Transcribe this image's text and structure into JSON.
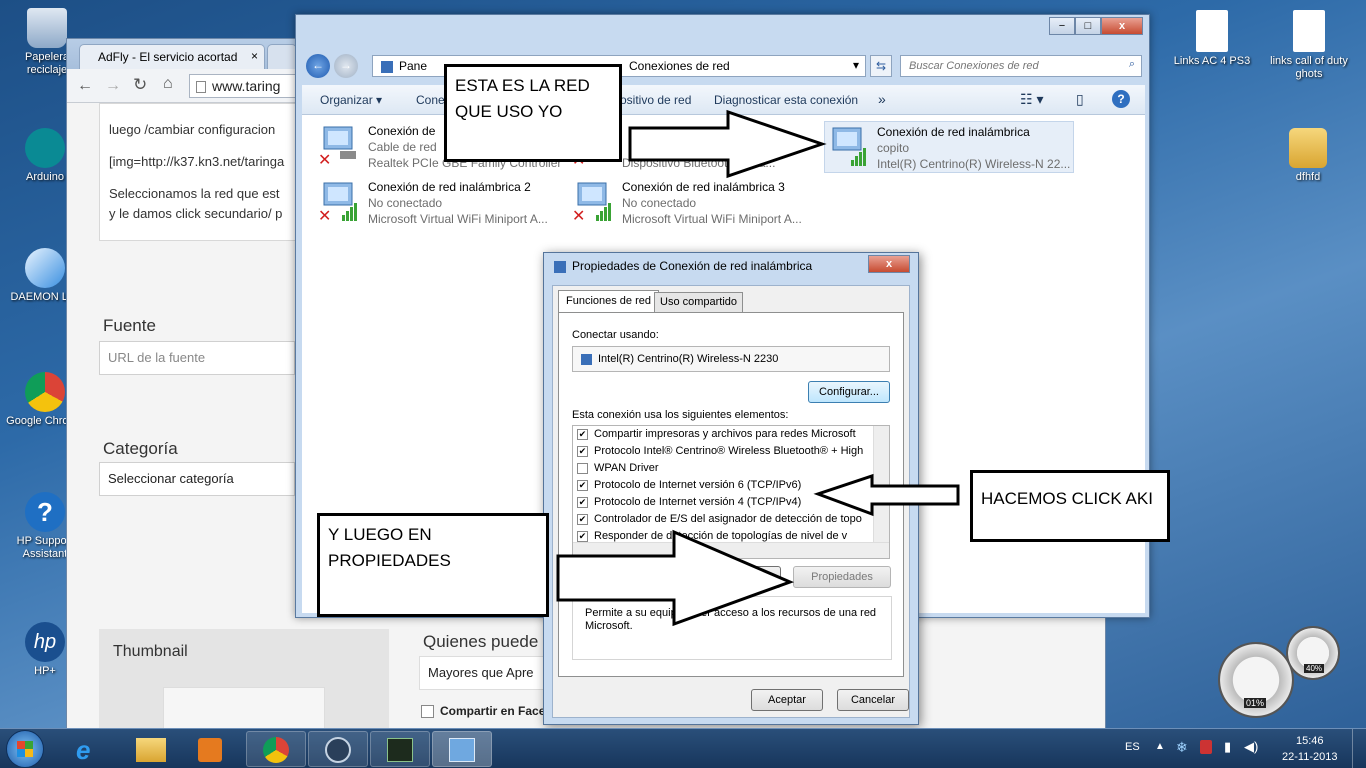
{
  "desktop": {
    "icons": [
      {
        "label": "Papelera reciclaje"
      },
      {
        "label": "Arduino"
      },
      {
        "label": "DAEMON Lite"
      },
      {
        "label": "Google Chrome"
      },
      {
        "label": "HP Support Assistant"
      },
      {
        "label": "HP+"
      },
      {
        "label": "Links AC 4 PS3"
      },
      {
        "label": "links call of duty ghots"
      },
      {
        "label": "dfhfd"
      }
    ]
  },
  "browser": {
    "tabs": [
      {
        "label": "AdFly - El servicio acortad"
      },
      {
        "label": ""
      }
    ],
    "tab_close": "×",
    "address": "www.taring",
    "content": {
      "line1": "luego  /cambiar configuracion",
      "line2": "[img=http://k37.kn3.net/taringa",
      "line3": "Seleccionamos la red que est",
      "line4": "y le damos click secundario/ p",
      "fuente_label": "Fuente",
      "fuente_placeholder": "URL de la fuente",
      "categoria_label": "Categoría",
      "categoria_value": "Seleccionar categoría",
      "thumbnail_label": "Thumbnail",
      "quienes_label": "Quienes puede",
      "mayores_value": "Mayores que Apre",
      "compartir_label": "Compartir en Face"
    }
  },
  "explorer": {
    "breadcrumb_root": "Pane",
    "breadcrumb_current": "Conexiones de red",
    "search_placeholder": "Buscar Conexiones de red",
    "toolbar": {
      "organizar": "Organizar",
      "conectar": "Cone",
      "dispositivo": "ositivo de red",
      "diagnosticar": "Diagnosticar esta conexión",
      "more": "»"
    },
    "connections": [
      {
        "name": "Conexión de",
        "status": "Cable de red",
        "device": "Realtek PCIe GBE Family Controller"
      },
      {
        "name": "",
        "status": "",
        "device": "Dispositivo Bluetooth (área..."
      },
      {
        "name": "Conexión de red inalámbrica",
        "status": "copito",
        "device": "Intel(R) Centrino(R) Wireless-N 22..."
      },
      {
        "name": "Conexión de red inalámbrica 2",
        "status": "No conectado",
        "device": "Microsoft Virtual WiFi Miniport A..."
      },
      {
        "name": "Conexión de red inalámbrica 3",
        "status": "No conectado",
        "device": "Microsoft Virtual WiFi Miniport A..."
      }
    ]
  },
  "dialog": {
    "title": "Propiedades de Conexión de red inalámbrica",
    "close": "x",
    "tabs": [
      {
        "label": "Funciones de red"
      },
      {
        "label": "Uso compartido"
      }
    ],
    "connect_using_label": "Conectar usando:",
    "adapter": "Intel(R) Centrino(R) Wireless-N 2230",
    "configure_button": "Configurar...",
    "items_label": "Esta conexión usa los siguientes elementos:",
    "items": [
      {
        "label": "Compartir impresoras y archivos para redes Microsoft",
        "checked": true
      },
      {
        "label": "Protocolo Intel® Centrino® Wireless Bluetooth® + High",
        "checked": true
      },
      {
        "label": "WPAN Driver",
        "checked": false
      },
      {
        "label": "Protocolo de Internet versión 6 (TCP/IPv6)",
        "checked": true
      },
      {
        "label": "Protocolo de Internet versión 4 (TCP/IPv4)",
        "checked": true
      },
      {
        "label": "Controlador de E/S del asignador de detección de topo",
        "checked": true
      },
      {
        "label": "Responder de detección de topologías de nivel de v",
        "checked": true
      }
    ],
    "properties_button": "Propiedades",
    "description": "Permite a su equipo tener acceso a los recursos de una red Microsoft.",
    "accept_button": "Aceptar",
    "cancel_button": "Cancelar"
  },
  "callouts": {
    "red": "ESTA ES LA RED QUE USO YO",
    "click": "HACEMOS CLICK AKI",
    "propiedades": "Y LUEGO EN PROPIEDADES"
  },
  "taskbar": {
    "language": "ES",
    "time": "15:46",
    "date": "22-11-2013"
  },
  "gadget": {
    "cpu": "01%",
    "ram": "40%"
  },
  "colors": {
    "taskbar": "#1d3d63",
    "desktop": "#2d6aa8",
    "selection": "#e6eef8",
    "signal": "#3aa335"
  }
}
